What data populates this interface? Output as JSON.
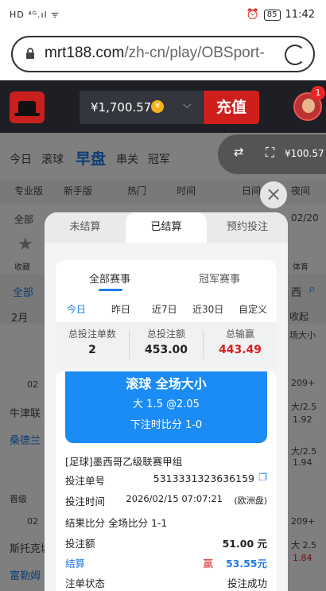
{
  "status": {
    "left": "HD ⁴ᴳ.ıl ᯤ",
    "time": "11:42",
    "battery": "85"
  },
  "browser": {
    "url_host": "mrt188.com",
    "url_path": "/zh-cn/play/OBSport-"
  },
  "header": {
    "balance": "¥1,700.57",
    "coin": "¥",
    "recharge": "充值",
    "notif": "1"
  },
  "background": {
    "nav": [
      "今日",
      "滚球",
      "早盘",
      "串关",
      "冠军"
    ],
    "nav_active": "早盘",
    "modes": [
      "专业版",
      "新手版"
    ],
    "sorts": [
      "热门",
      "时间"
    ],
    "right_opts": [
      "日间",
      "夜间"
    ],
    "all": "全部",
    "date_right": "02/20",
    "sport1": "收藏",
    "sport2": "体育",
    "all2": "全部",
    "west": "西",
    "month": "2月",
    "collapse": "收起",
    "teams": [
      "牛津联",
      "桑德兰",
      "斯托克城",
      "富勒姆"
    ],
    "league_left": "晋级",
    "odds": [
      "场大小",
      "209+",
      "大/2.5",
      "1.92",
      "大/2.5",
      "1.94",
      "209+",
      "大 2.5",
      "1.84"
    ],
    "dates": [
      "02",
      "02",
      "02"
    ],
    "pill_amt": "¥100.57"
  },
  "modal": {
    "tabs": [
      "未结算",
      "已结算",
      "预约投注"
    ],
    "subtabs": [
      "全部赛事",
      "冠军赛事"
    ],
    "dates": [
      "今日",
      "昨日",
      "近7日",
      "近30日",
      "自定义"
    ],
    "stats": [
      {
        "label": "总投注单数",
        "value": "2"
      },
      {
        "label": "总投注额",
        "value": "453.00"
      },
      {
        "label": "总输赢",
        "value": "443.49"
      }
    ],
    "bet": {
      "title": "滚球 全场大小",
      "selection": "大 1.5  @2.05",
      "score_at_bet": "下注时比分 1-0",
      "league": "[足球]墨西哥乙级联赛甲组",
      "ticket_label": "投注单号",
      "ticket_no": "5313331323636159",
      "time_label": "投注时间",
      "time_val": "2026/02/15 07:07:21",
      "time_zone": "(欧洲盘)",
      "result_label": "结果比分 全场比分 1-1",
      "stake_label": "投注额",
      "stake_val": "51.00 元",
      "settle_label": "结算",
      "settle_tag": "赢",
      "settle_val": "53.55元",
      "status_label": "注单状态",
      "status_val": "投注成功"
    }
  }
}
